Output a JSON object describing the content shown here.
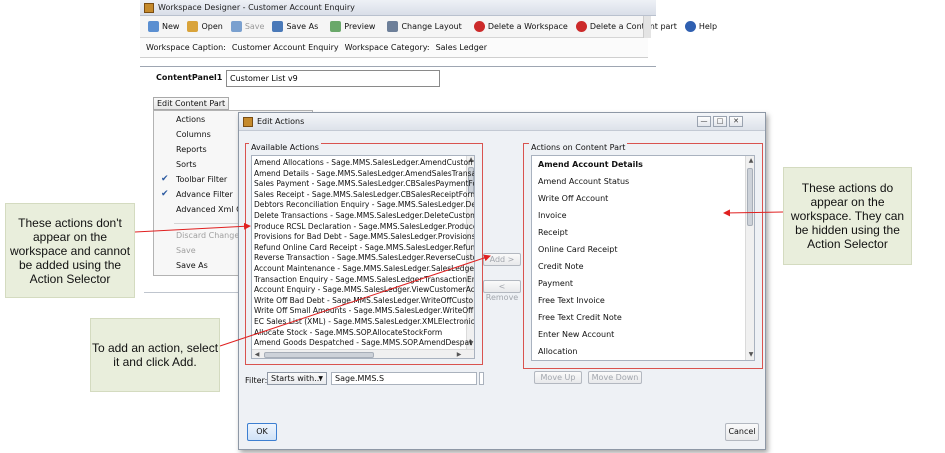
{
  "designer": {
    "title": "Workspace Designer - Customer Account Enquiry",
    "toolbar": [
      {
        "label": "New",
        "icon": "new-icon",
        "color": "#5b8fd1"
      },
      {
        "label": "Open",
        "icon": "open-folder-icon",
        "color": "#d9a33a"
      },
      {
        "label": "Save",
        "icon": "save-icon",
        "color": "#7aa0cf",
        "disabled": true
      },
      {
        "label": "Save As",
        "icon": "save-as-icon",
        "color": "#4a79b8"
      },
      {
        "label": "Preview",
        "icon": "preview-icon",
        "color": "#6aa86a"
      },
      {
        "label": "Change Layout",
        "icon": "layout-icon",
        "color": "#6d7f99"
      },
      {
        "label": "Delete a Workspace",
        "icon": "delete-icon",
        "color": "#cc2a2a"
      },
      {
        "label": "Delete a Content part",
        "icon": "delete-icon",
        "color": "#cc2a2a"
      },
      {
        "label": "Help",
        "icon": "help-icon",
        "color": "#2f5fb0"
      }
    ],
    "caption_label": "Workspace Caption:",
    "caption_value": "Customer Account Enquiry",
    "category_label": "Workspace Category:",
    "category_value": "Sales Ledger",
    "content_panel_label": "ContentPanel1",
    "content_panel_value": "Customer List v9",
    "edit_button": "Edit Content Part",
    "menu": [
      {
        "label": "Actions"
      },
      {
        "label": "Columns"
      },
      {
        "label": "Reports"
      },
      {
        "label": "Sorts"
      },
      {
        "label": "Toolbar Filter",
        "checked": true
      },
      {
        "label": "Advance Filter",
        "checked": true
      },
      {
        "label": "Advanced Xml Con"
      },
      {
        "label": "Discard Changes",
        "disabled": true
      },
      {
        "label": "Save",
        "disabled": true
      },
      {
        "label": "Save As"
      }
    ]
  },
  "dialog": {
    "title": "Edit Actions",
    "available_title": "Available Actions",
    "available_items": [
      "Amend Allocations - Sage.MMS.SalesLedger.AmendCustom",
      "Amend Details - Sage.MMS.SalesLedger.AmendSalesTransa",
      "Sales Payment - Sage.MMS.SalesLedger.CBSalesPaymentFo",
      "Sales Receipt - Sage.MMS.SalesLedger.CBSalesReceiptForm",
      "Debtors Reconciliation Enquiry - Sage.MMS.SalesLedger.De",
      "Delete Transactions - Sage.MMS.SalesLedger.DeleteCustom",
      "Produce RCSL Declaration - Sage.MMS.SalesLedger.Produce",
      "Provisions for Bad Debt - Sage.MMS.SalesLedger.Provisions",
      "Refund Online Card Receipt - Sage.MMS.SalesLedger.Refun",
      "Reverse Transaction - Sage.MMS.SalesLedger.ReverseCusto",
      "Account Maintenance - Sage.MMS.SalesLedger.SalesLedger",
      "Transaction Enquiry - Sage.MMS.SalesLedger.TransactionEn",
      "Account Enquiry - Sage.MMS.SalesLedger.ViewCustomerAc",
      "Write Off Bad Debt - Sage.MMS.SalesLedger.WriteOffCusto",
      "Write Off Small Amounts - Sage.MMS.SalesLedger.WriteOff",
      "EC Sales List (XML) - Sage.MMS.SalesLedger.XMLElectronicS",
      "Allocate Stock - Sage.MMS.SOP.AllocateStockForm",
      "Amend Goods Despatched - Sage.MMS.SOP.AmendDespat"
    ],
    "selected_title": "Actions on Content Part",
    "selected_items": [
      "Amend Account Details",
      "Amend Account Status",
      "Write Off Account",
      "Invoice",
      "Receipt",
      "Online Card Receipt",
      "Credit Note",
      "Payment",
      "Free Text Invoice",
      "Free Text Credit Note",
      "Enter New Account",
      "Allocation"
    ],
    "add_label": "Add >",
    "remove_label": "< Remove",
    "move_up_label": "Move Up",
    "move_down_label": "Move Down",
    "filter_label": "Filter:",
    "filter_mode": "Starts with...",
    "filter_value": "Sage.MMS.S",
    "ok_label": "OK",
    "cancel_label": "Cancel"
  },
  "callouts": {
    "left": "These actions don't appear on the workspace and cannot be added using the Action Selector",
    "bottom": "To add an action, select it and click Add.",
    "right": "These actions do appear on the workspace. They can be hidden using the Action Selector"
  },
  "colors": {
    "highlight_border": "#d9534f",
    "arrow": "#e02020",
    "callout_bg": "#e9eedc"
  }
}
